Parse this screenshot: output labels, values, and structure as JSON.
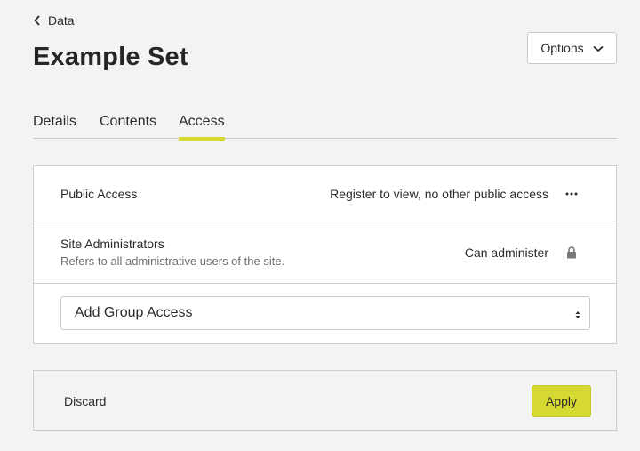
{
  "breadcrumb": {
    "label": "Data"
  },
  "page": {
    "title": "Example Set"
  },
  "header": {
    "options_label": "Options"
  },
  "tabs": [
    {
      "label": "Details",
      "active": false
    },
    {
      "label": "Contents",
      "active": false
    },
    {
      "label": "Access",
      "active": true
    }
  ],
  "access": {
    "rows": [
      {
        "label": "Public Access",
        "description": "",
        "value": "Register to view, no other public access",
        "icon": "more-icon"
      },
      {
        "label": "Site Administrators",
        "description": "Refers to all administrative users of the site.",
        "value": "Can administer",
        "icon": "lock-icon"
      }
    ],
    "add_group": {
      "selected": "Add Group Access"
    }
  },
  "footer": {
    "discard_label": "Discard",
    "apply_label": "Apply"
  },
  "colors": {
    "accent": "#d6d932",
    "background": "#f3f3f3",
    "border": "#cdcdcd"
  }
}
